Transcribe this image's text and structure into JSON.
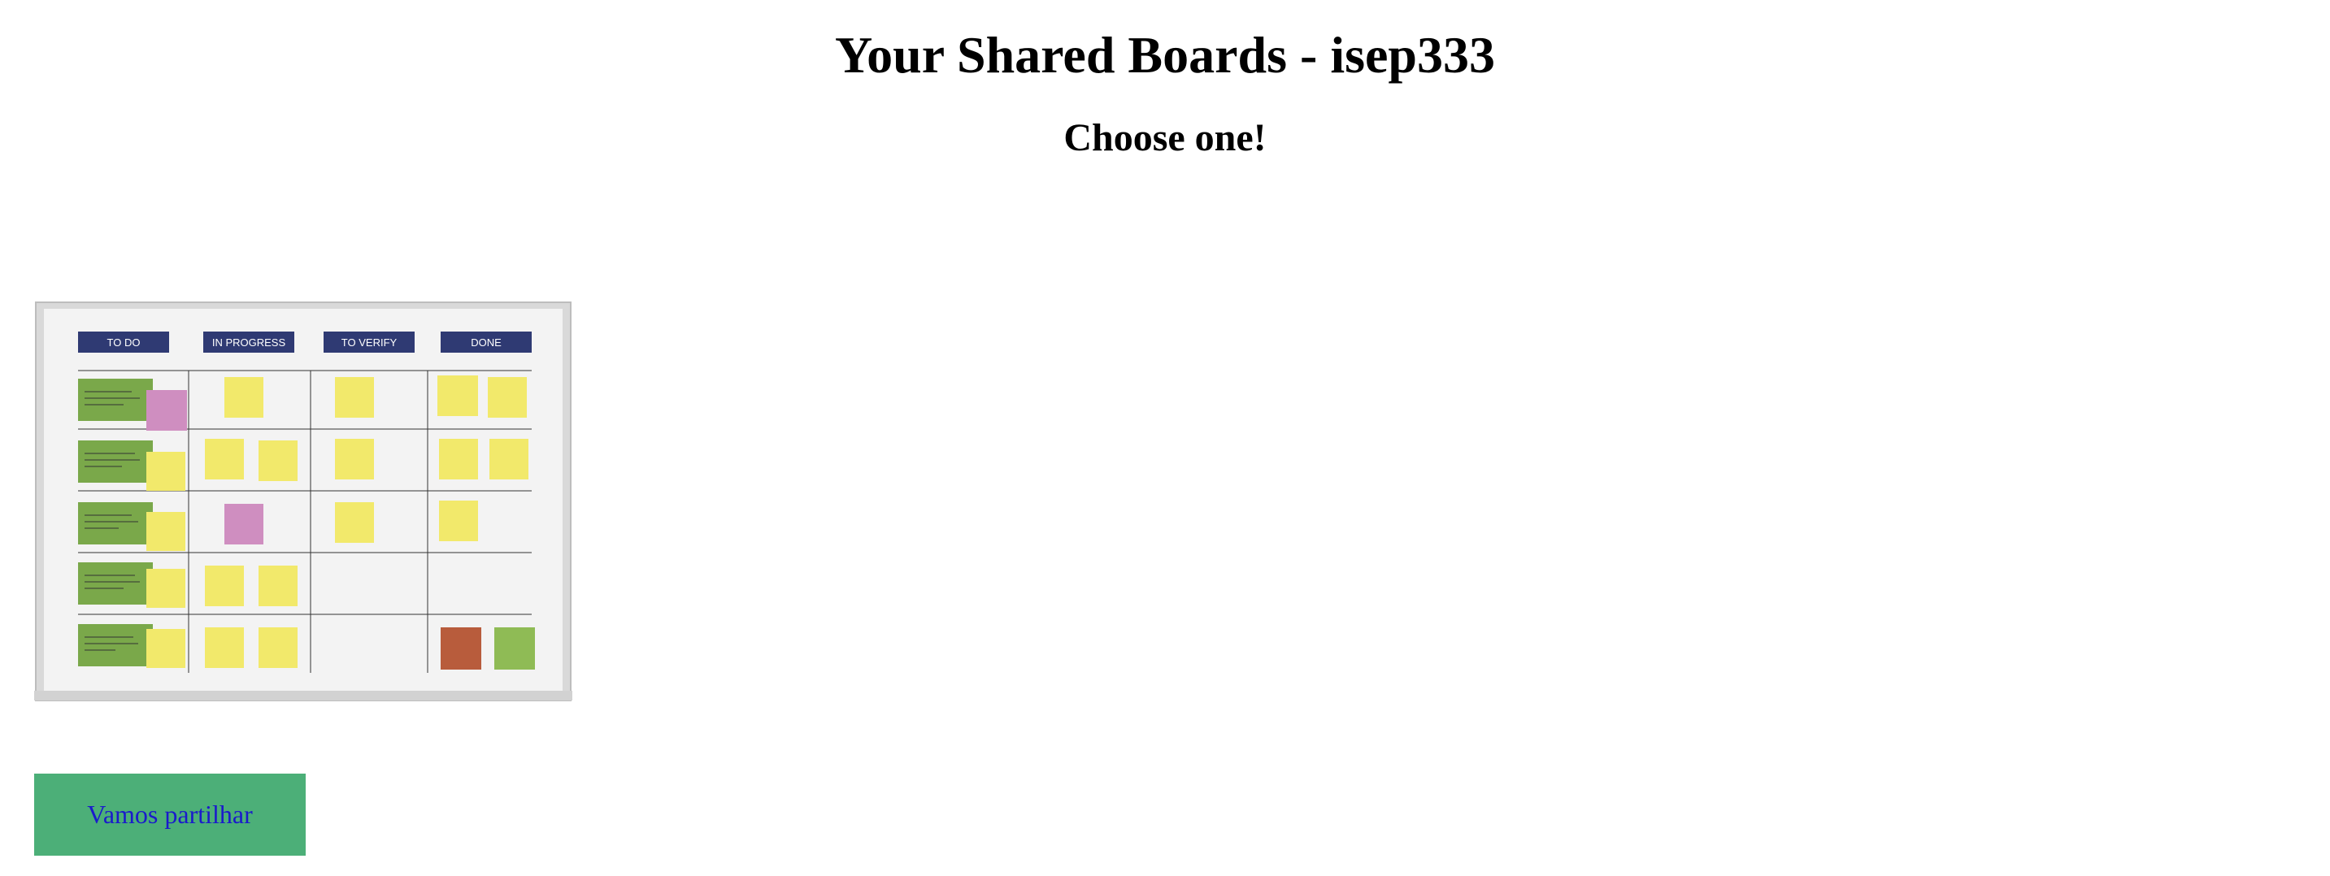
{
  "header": {
    "title": "Your Shared Boards - isep333",
    "subtitle": "Choose one!"
  },
  "boards": [
    {
      "name": "Vamos partilhar",
      "thumbnail": {
        "columns": [
          "TO DO",
          "IN PROGRESS",
          "TO VERIFY",
          "DONE"
        ],
        "colors": {
          "header": "#2f3a73",
          "story": "#7aa84a",
          "note_yellow": "#f2e96b",
          "note_pink": "#cf8ec0",
          "note_red": "#b85c3c",
          "note_green": "#8fbb55"
        }
      },
      "button_color": "#4caf78",
      "label_color": "#1a1acc"
    }
  ]
}
